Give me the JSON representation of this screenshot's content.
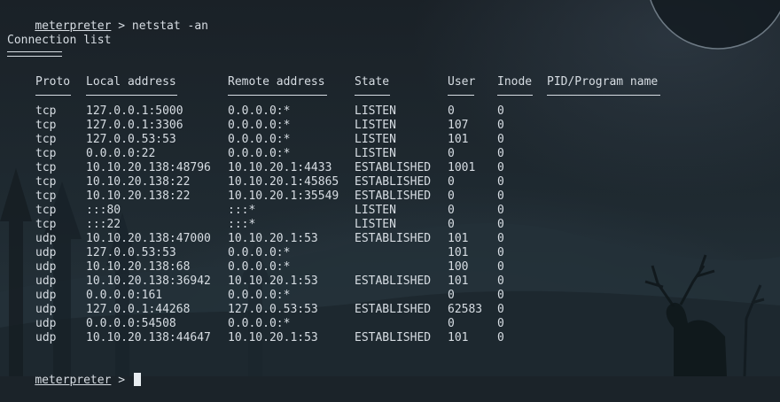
{
  "terminal": {
    "prompt": "meterpreter",
    "prompt_sep": " > ",
    "command": "netstat -an",
    "heading": "Connection list",
    "columns": [
      "Proto",
      "Local address",
      "Remote address",
      "State",
      "User",
      "Inode",
      "PID/Program name"
    ],
    "rows": [
      [
        "tcp",
        "127.0.0.1:5000",
        "0.0.0.0:*",
        "LISTEN",
        "0",
        "0",
        ""
      ],
      [
        "tcp",
        "127.0.0.1:3306",
        "0.0.0.0:*",
        "LISTEN",
        "107",
        "0",
        ""
      ],
      [
        "tcp",
        "127.0.0.53:53",
        "0.0.0.0:*",
        "LISTEN",
        "101",
        "0",
        ""
      ],
      [
        "tcp",
        "0.0.0.0:22",
        "0.0.0.0:*",
        "LISTEN",
        "0",
        "0",
        ""
      ],
      [
        "tcp",
        "10.10.20.138:48796",
        "10.10.20.1:4433",
        "ESTABLISHED",
        "1001",
        "0",
        ""
      ],
      [
        "tcp",
        "10.10.20.138:22",
        "10.10.20.1:45865",
        "ESTABLISHED",
        "0",
        "0",
        ""
      ],
      [
        "tcp",
        "10.10.20.138:22",
        "10.10.20.1:35549",
        "ESTABLISHED",
        "0",
        "0",
        ""
      ],
      [
        "tcp",
        ":::80",
        ":::*",
        "LISTEN",
        "0",
        "0",
        ""
      ],
      [
        "tcp",
        ":::22",
        ":::*",
        "LISTEN",
        "0",
        "0",
        ""
      ],
      [
        "udp",
        "10.10.20.138:47000",
        "10.10.20.1:53",
        "ESTABLISHED",
        "101",
        "0",
        ""
      ],
      [
        "udp",
        "127.0.0.53:53",
        "0.0.0.0:*",
        "",
        "101",
        "0",
        ""
      ],
      [
        "udp",
        "10.10.20.138:68",
        "0.0.0.0:*",
        "",
        "100",
        "0",
        ""
      ],
      [
        "udp",
        "10.10.20.138:36942",
        "10.10.20.1:53",
        "ESTABLISHED",
        "101",
        "0",
        ""
      ],
      [
        "udp",
        "0.0.0.0:161",
        "0.0.0.0:*",
        "",
        "0",
        "0",
        ""
      ],
      [
        "udp",
        "127.0.0.1:44268",
        "127.0.0.53:53",
        "ESTABLISHED",
        "62583",
        "0",
        ""
      ],
      [
        "udp",
        "0.0.0.0:54508",
        "0.0.0.0:*",
        "",
        "0",
        "0",
        ""
      ],
      [
        "udp",
        "10.10.20.138:44647",
        "10.10.20.1:53",
        "ESTABLISHED",
        "101",
        "0",
        ""
      ]
    ]
  },
  "theme": {
    "background": "#1b2329",
    "text": "#d7dde3"
  }
}
